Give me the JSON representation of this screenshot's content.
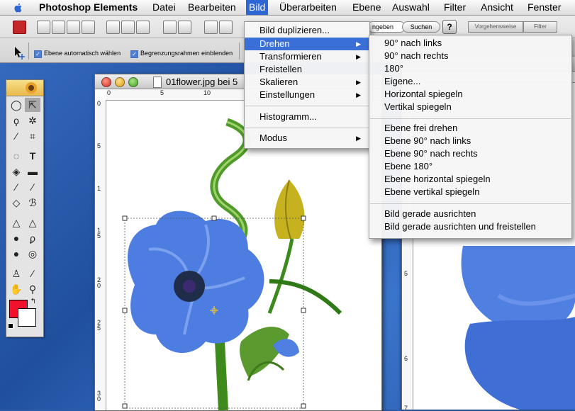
{
  "menubar": {
    "app_name": "Photoshop Elements",
    "items": [
      "Datei",
      "Bearbeiten",
      "Bild",
      "Überarbeiten",
      "Ebene",
      "Auswahl",
      "Filter",
      "Ansicht",
      "Fenster"
    ]
  },
  "toolbar": {
    "auto_select_label": "Ebene automatisch wählen",
    "bounding_box_label": "Begrenzungsrahmen einblenden",
    "search_placeholder": "ngeben",
    "search_button": "Suchen",
    "help_label": "?",
    "palette_tab_1": "Vorgehensweise",
    "palette_tab_2": "Filter"
  },
  "document": {
    "title": "01flower.jpg bei 5",
    "ruler_top": [
      "0",
      "5",
      "10"
    ],
    "ruler_left": [
      "0",
      "5",
      "1",
      "1\n5",
      "2\n0",
      "2\n5",
      "3\n0"
    ]
  },
  "document2": {
    "ruler_left": [
      "5",
      "6",
      "7"
    ]
  },
  "bild_menu": {
    "items": [
      {
        "label": "Bild duplizieren...",
        "arrow": false
      },
      {
        "label": "Drehen",
        "arrow": true,
        "highlighted": true
      },
      {
        "label": "Transformieren",
        "arrow": true
      },
      {
        "label": "Freistellen",
        "arrow": false
      },
      {
        "label": "Skalieren",
        "arrow": true
      },
      {
        "label": "Einstellungen",
        "arrow": true
      },
      {
        "label": "Histogramm...",
        "arrow": false
      },
      {
        "label": "Modus",
        "arrow": true
      }
    ]
  },
  "drehen_menu": {
    "items": [
      "90° nach links",
      "90° nach rechts",
      "180°",
      "Eigene...",
      "Horizontal spiegeln",
      "Vertikal spiegeln",
      "Ebene frei drehen",
      "Ebene 90° nach links",
      "Ebene 90° nach rechts",
      "Ebene 180°",
      "Ebene horizontal spiegeln",
      "Ebene vertikal spiegeln",
      "Bild gerade ausrichten",
      "Bild gerade ausrichten und freistellen"
    ]
  },
  "colors": {
    "menu_highlight": "#3a6fd8",
    "foreground": "#f2112a",
    "background": "#ffffff",
    "flower_blue": "#4d7de0"
  },
  "icons": {
    "apple": "apple-logo-icon",
    "tools": [
      "marquee-icon",
      "move-icon",
      "lasso-icon",
      "magic-wand-icon",
      "crop-icon",
      "brush-icon",
      "text-icon",
      "bucket-icon",
      "gradient-icon",
      "pencil-icon",
      "eraser-icon",
      "blur-icon",
      "smudge-icon",
      "sponge-icon",
      "red-eye-icon",
      "stamp-icon",
      "eyedropper-icon",
      "hand-icon",
      "zoom-icon"
    ]
  }
}
